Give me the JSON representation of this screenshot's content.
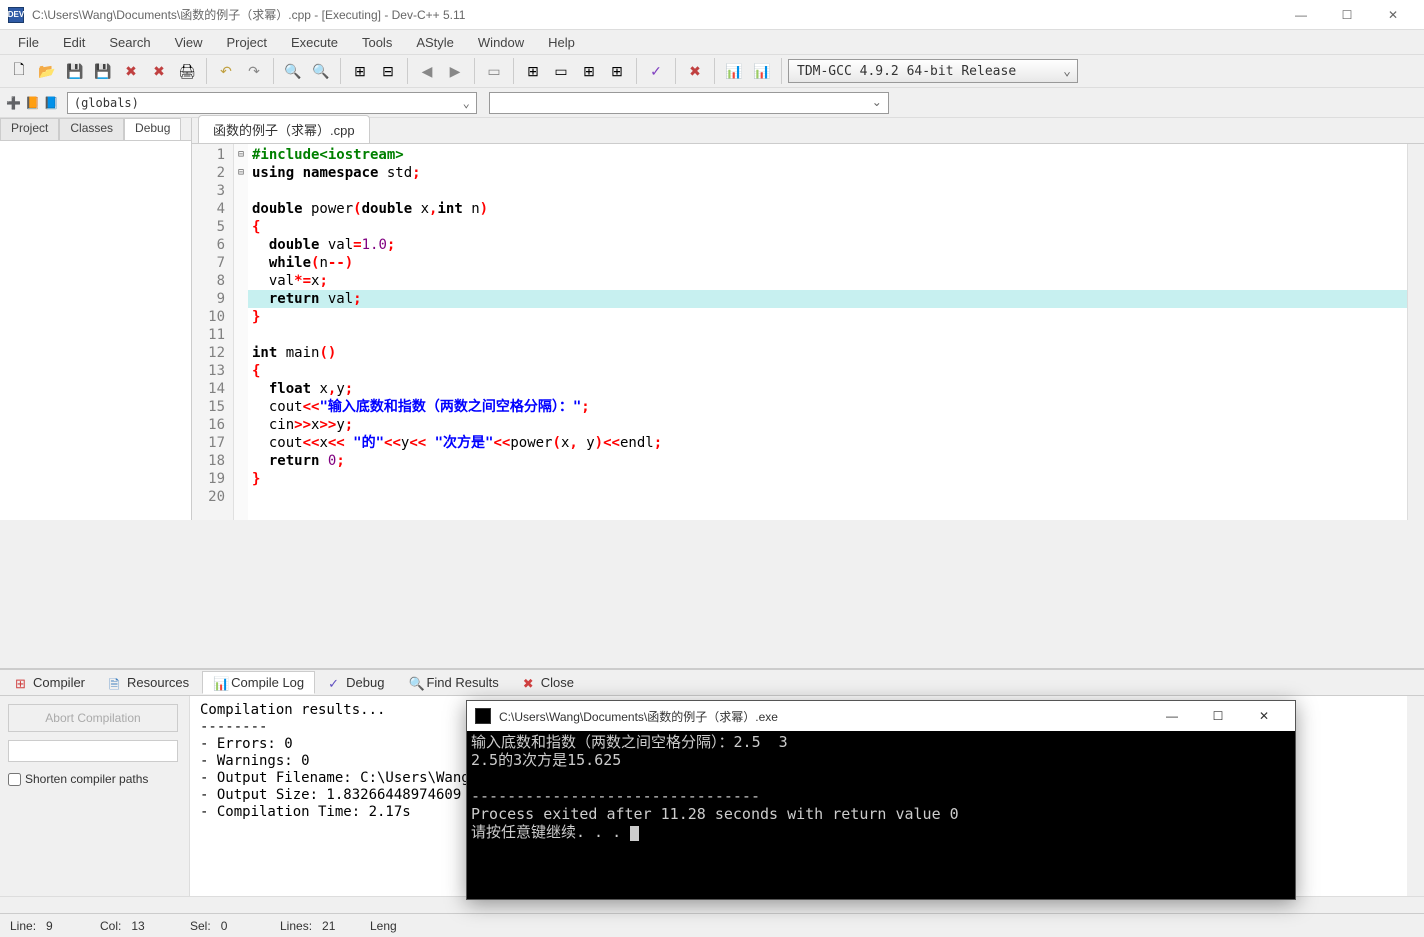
{
  "window": {
    "title": "C:\\Users\\Wang\\Documents\\函数的例子（求幂）.cpp - [Executing] - Dev-C++ 5.11"
  },
  "menu": [
    "File",
    "Edit",
    "Search",
    "View",
    "Project",
    "Execute",
    "Tools",
    "AStyle",
    "Window",
    "Help"
  ],
  "compiler_selector": "TDM-GCC 4.9.2 64-bit Release",
  "globals": "(globals)",
  "left_tabs": [
    "Project",
    "Classes",
    "Debug"
  ],
  "left_active": "Debug",
  "file_tab": "函数的例子（求幂）.cpp",
  "code_lines": [
    {
      "n": 1,
      "fold": "",
      "html": "<span class='pp'>#include&lt;iostream&gt;</span>"
    },
    {
      "n": 2,
      "fold": "",
      "html": "<span class='kw'>using</span> <span class='kw'>namespace</span> std<span class='op'>;</span>"
    },
    {
      "n": 3,
      "fold": "",
      "html": ""
    },
    {
      "n": 4,
      "fold": "",
      "html": "<span class='kw'>double</span> power<span class='op'>(</span><span class='kw'>double</span> x<span class='op'>,</span><span class='kw'>int</span> n<span class='op'>)</span>"
    },
    {
      "n": 5,
      "fold": "⊟",
      "html": "<span class='op'>{</span>"
    },
    {
      "n": 6,
      "fold": "",
      "html": "  <span class='kw'>double</span> val<span class='op'>=</span><span class='num'>1.0</span><span class='op'>;</span>"
    },
    {
      "n": 7,
      "fold": "",
      "html": "  <span class='kw'>while</span><span class='op'>(</span>n<span class='op'>--</span><span class='op'>)</span>"
    },
    {
      "n": 8,
      "fold": "",
      "html": "  val<span class='op'>*=</span>x<span class='op'>;</span>"
    },
    {
      "n": 9,
      "fold": "",
      "hl": true,
      "html": "  <span class='kw'>return</span> val<span class='op'>;</span>"
    },
    {
      "n": 10,
      "fold": "",
      "html": "<span class='op'>}</span>"
    },
    {
      "n": 11,
      "fold": "",
      "html": ""
    },
    {
      "n": 12,
      "fold": "",
      "html": "<span class='kw'>int</span> main<span class='op'>()</span>"
    },
    {
      "n": 13,
      "fold": "⊟",
      "html": "<span class='op'>{</span>"
    },
    {
      "n": 14,
      "fold": "",
      "html": "  <span class='kw'>float</span> x<span class='op'>,</span>y<span class='op'>;</span>"
    },
    {
      "n": 15,
      "fold": "",
      "html": "  cout<span class='op'>&lt;&lt;</span><span class='str'>\"输入底数和指数（两数之间空格分隔）：\"</span><span class='op'>;</span>"
    },
    {
      "n": 16,
      "fold": "",
      "html": "  cin<span class='op'>&gt;&gt;</span>x<span class='op'>&gt;&gt;</span>y<span class='op'>;</span>"
    },
    {
      "n": 17,
      "fold": "",
      "html": "  cout<span class='op'>&lt;&lt;</span>x<span class='op'>&lt;&lt;</span> <span class='str'>\"的\"</span><span class='op'>&lt;&lt;</span>y<span class='op'>&lt;&lt;</span> <span class='str'>\"次方是\"</span><span class='op'>&lt;&lt;</span>power<span class='op'>(</span>x<span class='op'>,</span> y<span class='op'>)</span><span class='op'>&lt;&lt;</span>endl<span class='op'>;</span>"
    },
    {
      "n": 18,
      "fold": "",
      "html": "  <span class='kw'>return</span> <span class='num'>0</span><span class='op'>;</span>"
    },
    {
      "n": 19,
      "fold": "",
      "html": "<span class='op'>}</span>"
    },
    {
      "n": 20,
      "fold": "",
      "html": ""
    }
  ],
  "bottom_tabs": [
    {
      "icon": "⊞",
      "label": "Compiler",
      "color": "#d04040"
    },
    {
      "icon": "🗎",
      "label": "Resources",
      "color": "#4080c0"
    },
    {
      "icon": "📊",
      "label": "Compile Log",
      "active": true,
      "color": "#4080c0"
    },
    {
      "icon": "✓",
      "label": "Debug",
      "color": "#6050c0"
    },
    {
      "icon": "🔍",
      "label": "Find Results",
      "color": "#4080c0"
    },
    {
      "icon": "✖",
      "label": "Close",
      "color": "#d04040"
    }
  ],
  "abort_label": "Abort Compilation",
  "shorten_label": "Shorten compiler paths",
  "compile_log": "Compilation results...\n--------\n- Errors: 0\n- Warnings: 0\n- Output Filename: C:\\Users\\Wang\\Documents\\函数的例子（求幂）.exe\n- Output Size: 1.83266448974609 MiB\n- Compilation Time: 2.17s",
  "status": {
    "line_label": "Line:",
    "line": "9",
    "col_label": "Col:",
    "col": "13",
    "sel_label": "Sel:",
    "sel": "0",
    "lines_label": "Lines:",
    "lines": "21",
    "len_label": "Leng"
  },
  "console": {
    "title": "C:\\Users\\Wang\\Documents\\函数的例子（求幂）.exe",
    "body": "输入底数和指数（两数之间空格分隔）：2.5  3\n2.5的3次方是15.625\n\n--------------------------------\nProcess exited after 11.28 seconds with return value 0\n请按任意键继续. . . "
  }
}
